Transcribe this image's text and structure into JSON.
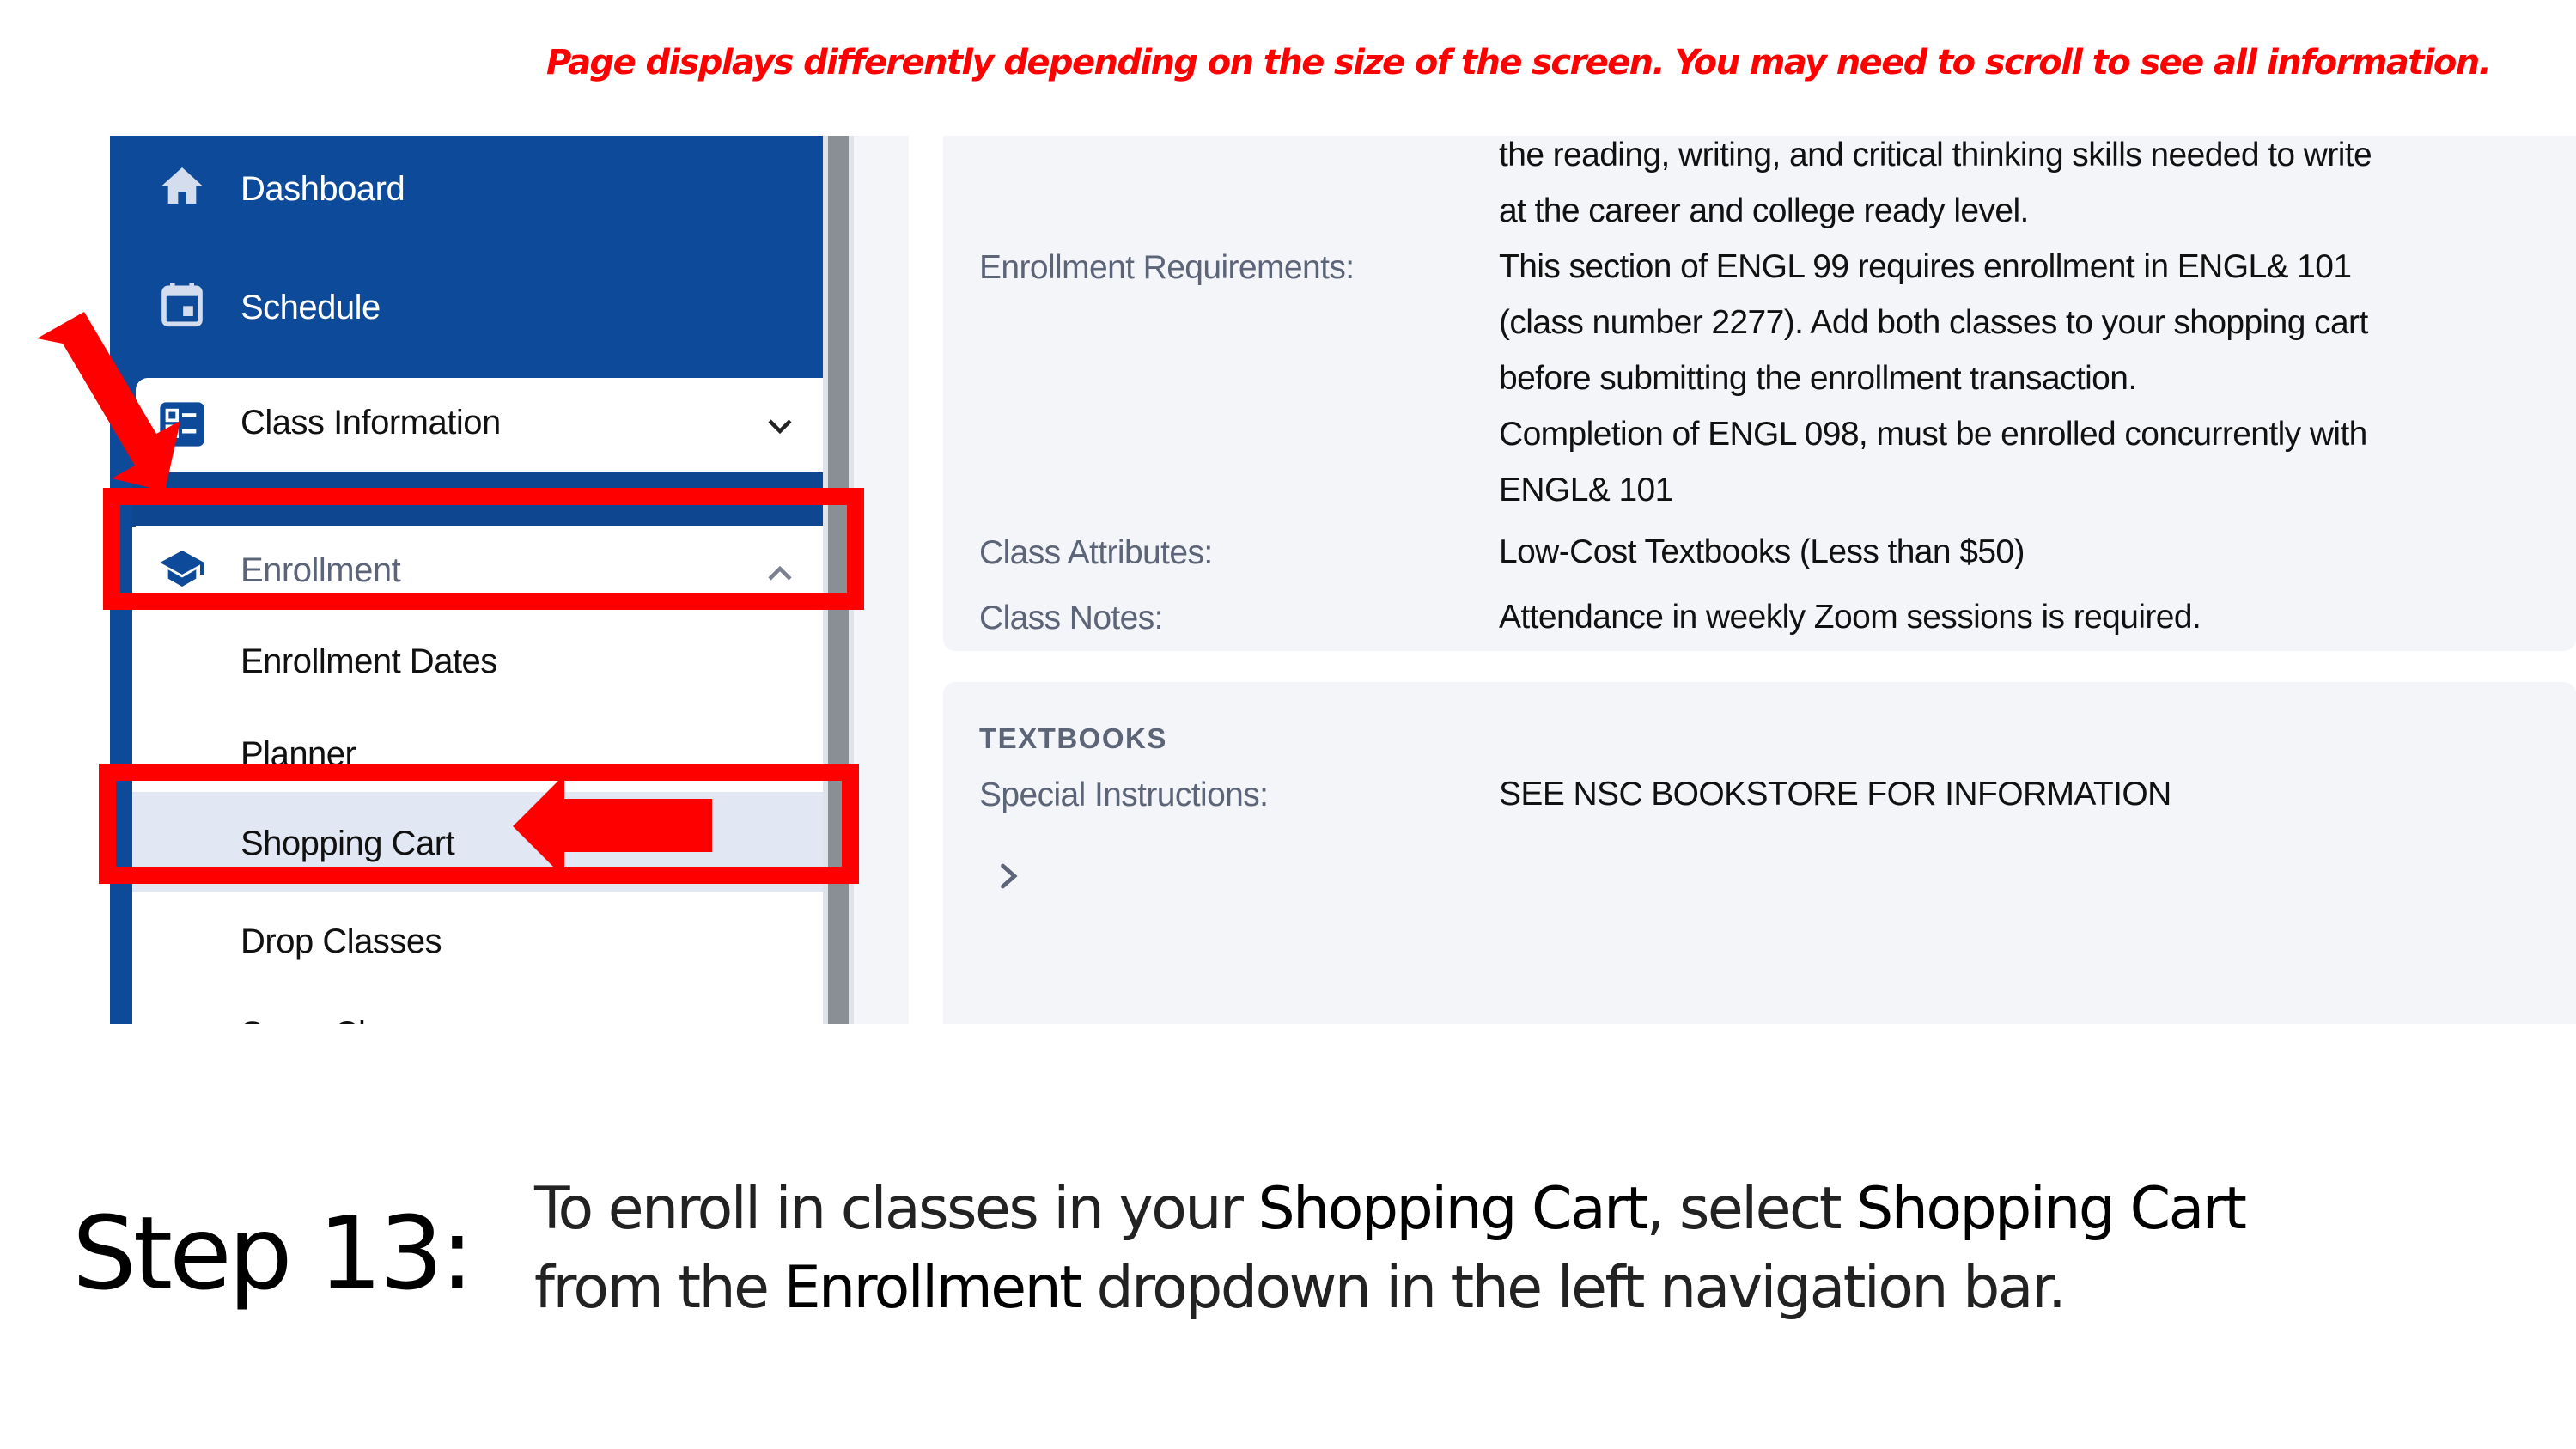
{
  "notice": "Page displays differently depending on the size of the screen. You may need to scroll to see all information.",
  "sidebar": {
    "items": [
      {
        "label": "Dashboard",
        "icon": "home-icon"
      },
      {
        "label": "Schedule",
        "icon": "calendar-icon"
      },
      {
        "label": "Class Information",
        "icon": "class-info-icon",
        "expanded": false
      },
      {
        "label": "Enrollment",
        "icon": "graduation-cap-icon",
        "expanded": true
      }
    ],
    "enrollment_subitems": [
      {
        "label": "Enrollment Dates",
        "active": false
      },
      {
        "label": "Planner",
        "active": false
      },
      {
        "label": "Shopping Cart",
        "active": true
      },
      {
        "label": "Drop Classes",
        "active": false
      },
      {
        "label": "Swap Classes",
        "active": false
      }
    ]
  },
  "details": {
    "description_tail": [
      "the reading, writing, and critical thinking skills needed to write",
      "at the career and college ready level."
    ],
    "enrollment_requirements": {
      "label": "Enrollment Requirements:",
      "lines": [
        "This section of ENGL 99 requires enrollment in ENGL& 101",
        "(class number 2277). Add both classes to your shopping cart",
        "before submitting the enrollment transaction.",
        "Completion of ENGL 098, must be enrolled concurrently with",
        "ENGL& 101"
      ]
    },
    "class_attributes": {
      "label": "Class Attributes:",
      "value": "Low-Cost Textbooks (Less than $50)"
    },
    "class_notes": {
      "label": "Class Notes:",
      "value": "Attendance in weekly Zoom sessions is required."
    }
  },
  "textbooks": {
    "title": "TEXTBOOKS",
    "special_instructions": {
      "label": "Special Instructions:",
      "value": "SEE NSC BOOKSTORE FOR INFORMATION"
    }
  },
  "step": {
    "label": "Step 13:",
    "line1": {
      "pre": "To enroll in classes in your ",
      "em1": "Shopping Cart",
      "mid": ", select ",
      "em2": "Shopping Cart"
    },
    "line2": {
      "pre": "from the ",
      "em": "Enrollment",
      "post": " dropdown in the left navigation bar."
    }
  },
  "colors": {
    "annotation": "#ff0000",
    "sidebar_blue": "#0d4a99",
    "active_item_bg": "#e1e8f3",
    "card_bg": "#f4f5f9",
    "label_gray": "#5c6478"
  }
}
